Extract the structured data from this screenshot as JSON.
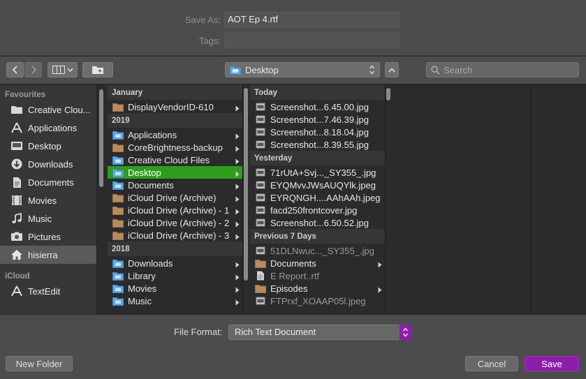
{
  "form": {
    "save_as_label": "Save As:",
    "save_as_value": "AOT Ep 4.rtf",
    "tags_label": "Tags:",
    "tags_value": ""
  },
  "toolbar": {
    "location": "Desktop",
    "search_placeholder": "Search"
  },
  "sidebar": {
    "favourites_header": "Favourites",
    "favourites": [
      {
        "label": "Creative Clou...",
        "icon": "folder-icon"
      },
      {
        "label": "Applications",
        "icon": "applications-icon"
      },
      {
        "label": "Desktop",
        "icon": "desktop-icon"
      },
      {
        "label": "Downloads",
        "icon": "downloads-icon"
      },
      {
        "label": "Documents",
        "icon": "documents-icon"
      },
      {
        "label": "Movies",
        "icon": "movies-icon"
      },
      {
        "label": "Music",
        "icon": "music-icon"
      },
      {
        "label": "Pictures",
        "icon": "pictures-icon"
      },
      {
        "label": "hisierra",
        "icon": "home-icon",
        "selected": true
      }
    ],
    "icloud_header": "iCloud",
    "icloud": [
      {
        "label": "TextEdit",
        "icon": "textedit-icon"
      }
    ]
  },
  "column1": {
    "groups": [
      {
        "title": "January",
        "items": [
          {
            "label": "DisplayVendorID-610",
            "icon": "folder-brown-icon"
          }
        ]
      },
      {
        "title": "2019",
        "items": [
          {
            "label": "Applications",
            "icon": "folder-blue-icon"
          },
          {
            "label": "CoreBrightness-backup",
            "icon": "folder-brown-icon"
          },
          {
            "label": "Creative Cloud Files",
            "icon": "folder-blue-icon"
          },
          {
            "label": "Desktop",
            "icon": "folder-blue-icon",
            "selected": true
          },
          {
            "label": "Documents",
            "icon": "folder-blue-icon"
          },
          {
            "label": "iCloud Drive (Archive)",
            "icon": "folder-brown-icon"
          },
          {
            "label": "iCloud Drive (Archive) - 1",
            "icon": "folder-brown-icon"
          },
          {
            "label": "iCloud Drive (Archive) - 2",
            "icon": "folder-brown-icon"
          },
          {
            "label": "iCloud Drive (Archive) - 3",
            "icon": "folder-brown-icon"
          }
        ]
      },
      {
        "title": "2018",
        "items": [
          {
            "label": "Downloads",
            "icon": "folder-blue-icon"
          },
          {
            "label": "Library",
            "icon": "folder-blue-icon"
          },
          {
            "label": "Movies",
            "icon": "folder-blue-icon"
          },
          {
            "label": "Music",
            "icon": "folder-blue-icon"
          }
        ]
      }
    ]
  },
  "column2": {
    "groups": [
      {
        "title": "Today",
        "items": [
          {
            "label": "Screenshot...6.45.00.jpg",
            "icon": "image-file-icon"
          },
          {
            "label": "Screenshot...7.46.39.jpg",
            "icon": "image-file-icon"
          },
          {
            "label": "Screenshot...8.18.04.jpg",
            "icon": "image-file-icon"
          },
          {
            "label": "Screenshot...8.39.55.jpg",
            "icon": "image-file-icon"
          }
        ]
      },
      {
        "title": "Yesterday",
        "items": [
          {
            "label": "71rUtA+Svj..._SY355_.jpg",
            "icon": "image-file-icon"
          },
          {
            "label": "EYQMvvJWsAUQYlk.jpeg",
            "icon": "image-file-icon"
          },
          {
            "label": "EYRQNGH....AAhAAh.jpeg",
            "icon": "image-file-icon"
          },
          {
            "label": "facd250frontcover.jpg",
            "icon": "image-file-icon"
          },
          {
            "label": "Screenshot...6.50.52.jpg",
            "icon": "image-file-icon"
          }
        ]
      },
      {
        "title": "Previous 7 Days",
        "items": [
          {
            "label": "51DLNwuc..._SY355_.jpg",
            "icon": "image-file-icon",
            "dim": true
          },
          {
            "label": "Documents",
            "icon": "folder-brown-icon",
            "folder": true
          },
          {
            "label": "E Report..rtf",
            "icon": "document-file-icon",
            "dim": true
          },
          {
            "label": "Episodes",
            "icon": "folder-brown-icon",
            "folder": true
          },
          {
            "label": "FTPrxf_XOAAP05l.jpeg",
            "icon": "image-file-icon",
            "dim": true
          }
        ]
      }
    ]
  },
  "bottom": {
    "file_format_label": "File Format:",
    "file_format_value": "Rich Text Document",
    "new_folder_label": "New Folder",
    "cancel_label": "Cancel",
    "save_label": "Save"
  },
  "colors": {
    "accent": "#8b1fa9",
    "selection": "#2f9d1c"
  }
}
